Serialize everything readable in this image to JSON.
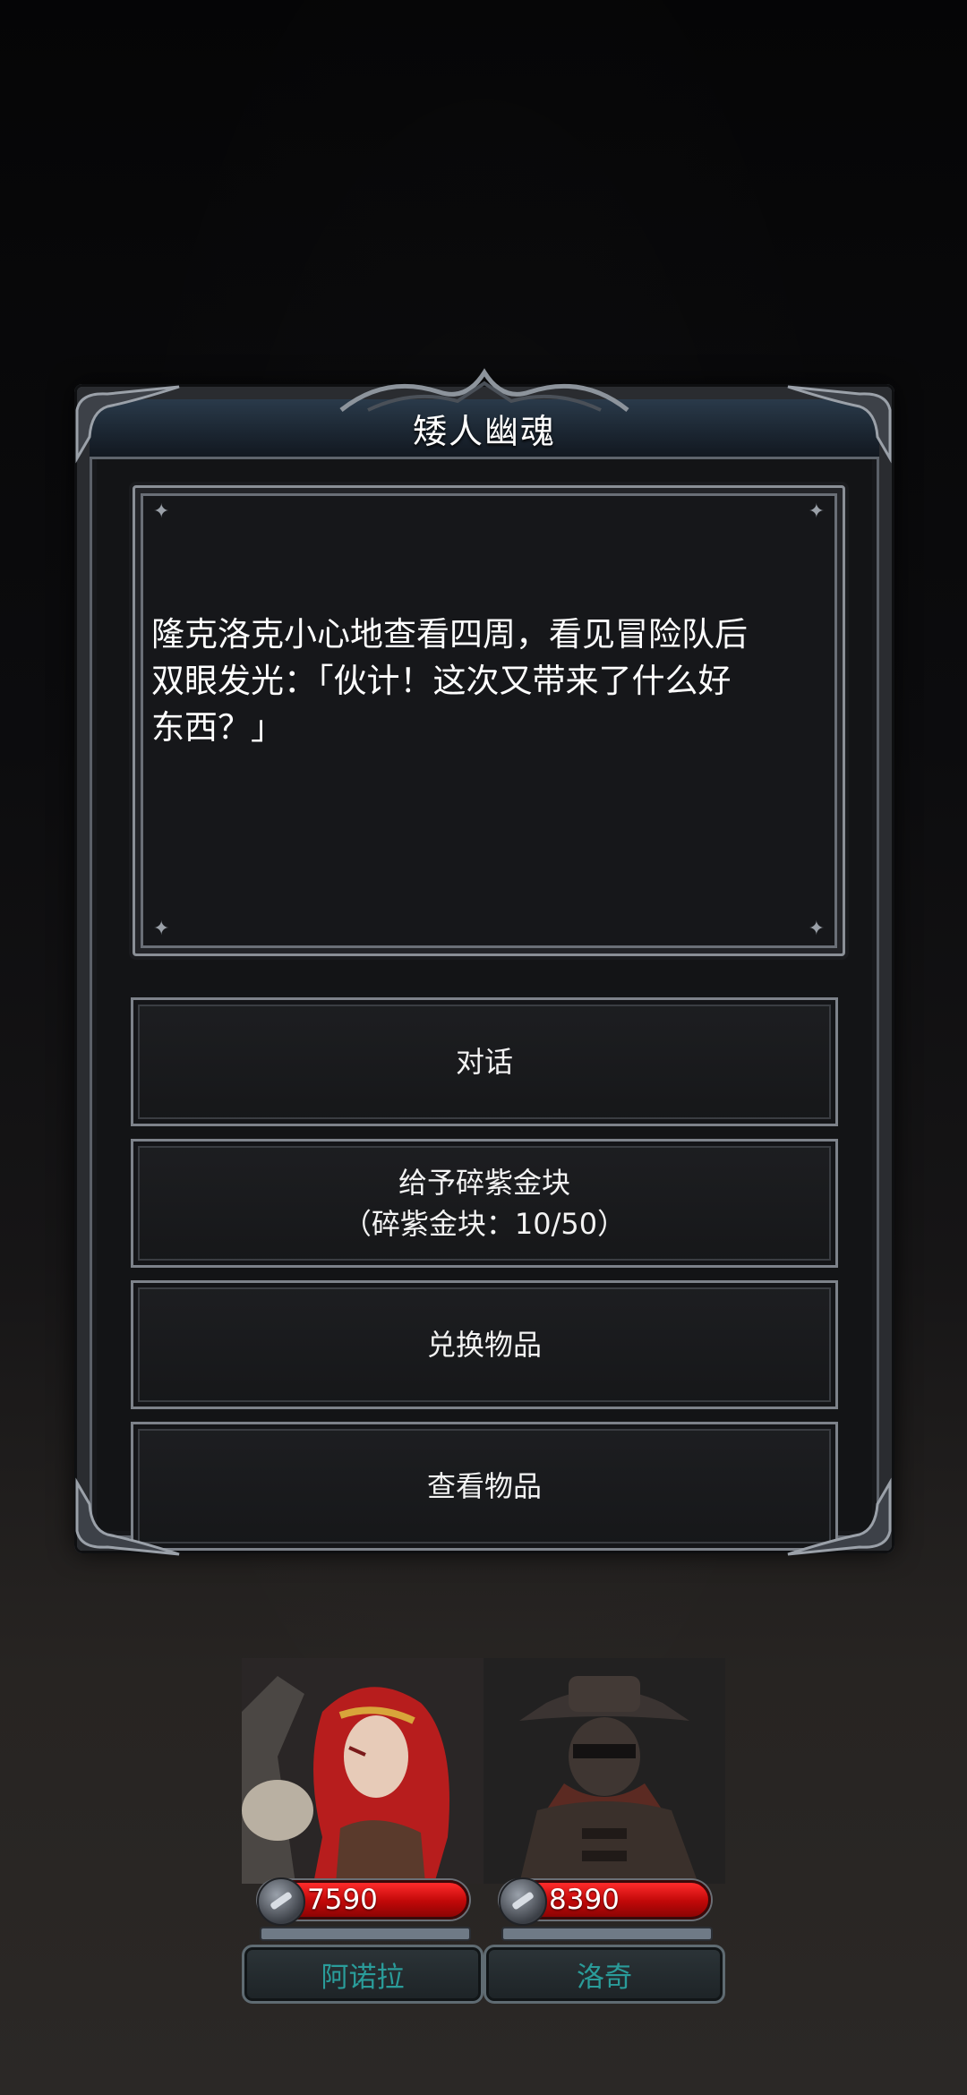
{
  "dialog": {
    "title": "矮人幽魂",
    "text": "隆克洛克小心地查看四周，看见冒险队后\n双眼发光：「伙计！这次又带来了什么好\n东西？」",
    "options": [
      {
        "label": "对话",
        "sub": ""
      },
      {
        "label": "给予碎紫金块",
        "sub": "（碎紫金块：10/50）"
      },
      {
        "label": "兑换物品",
        "sub": ""
      },
      {
        "label": "查看物品",
        "sub": ""
      }
    ]
  },
  "party": [
    {
      "name": "阿诺拉",
      "hp": "7590",
      "hp_fraction": 1.0,
      "portrait": "red-haired-warrior-portrait"
    },
    {
      "name": "洛奇",
      "hp": "8390",
      "hp_fraction": 1.0,
      "portrait": "masked-gunslinger-portrait"
    }
  ],
  "colors": {
    "hp_red": "#e01010",
    "name_teal": "#2a9c9a",
    "panel_border": "#7d828a"
  }
}
